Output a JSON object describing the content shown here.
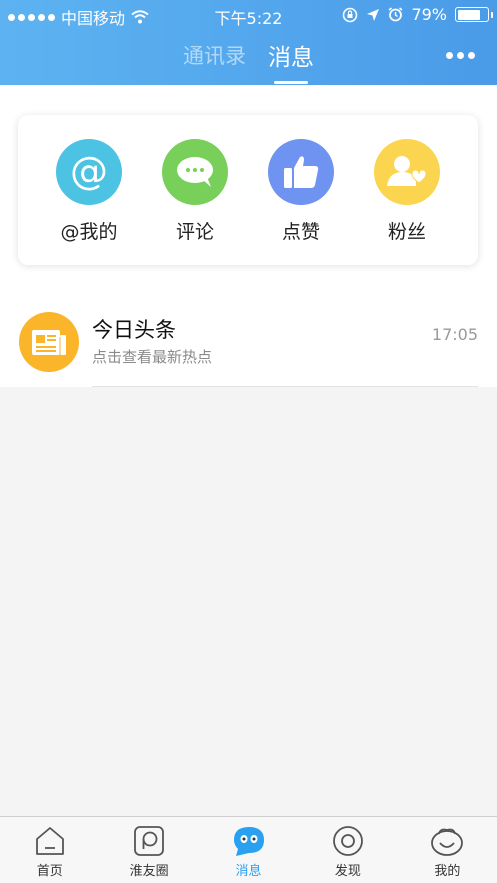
{
  "status_bar": {
    "carrier": "中国移动",
    "time": "下午5:22",
    "battery": "79%",
    "battery_level": 0.79
  },
  "header": {
    "tabs": [
      {
        "label": "通讯录",
        "active": false
      },
      {
        "label": "消息",
        "active": true
      }
    ],
    "more_icon": "more-icon"
  },
  "categories": [
    {
      "label": "@我的",
      "color": "#4dc3e3",
      "icon": "at-icon"
    },
    {
      "label": "评论",
      "color": "#78d05a",
      "icon": "comment-icon"
    },
    {
      "label": "点赞",
      "color": "#6f93f0",
      "icon": "thumbs-up-icon"
    },
    {
      "label": "粉丝",
      "color": "#fbd550",
      "icon": "fans-icon"
    }
  ],
  "messages": [
    {
      "title": "今日头条",
      "subtitle": "点击查看最新热点",
      "time": "17:05",
      "avatar_color": "#fbb52a",
      "icon": "newspaper-icon"
    }
  ],
  "bottom_nav": [
    {
      "label": "首页",
      "icon": "home-icon",
      "active": false
    },
    {
      "label": "淮友圈",
      "icon": "circle-icon",
      "active": false
    },
    {
      "label": "消息",
      "icon": "message-icon",
      "active": true
    },
    {
      "label": "发现",
      "icon": "discover-icon",
      "active": false
    },
    {
      "label": "我的",
      "icon": "profile-icon",
      "active": false
    }
  ],
  "colors": {
    "header": "#4a9be8",
    "active_nav": "#2aa0f0"
  }
}
